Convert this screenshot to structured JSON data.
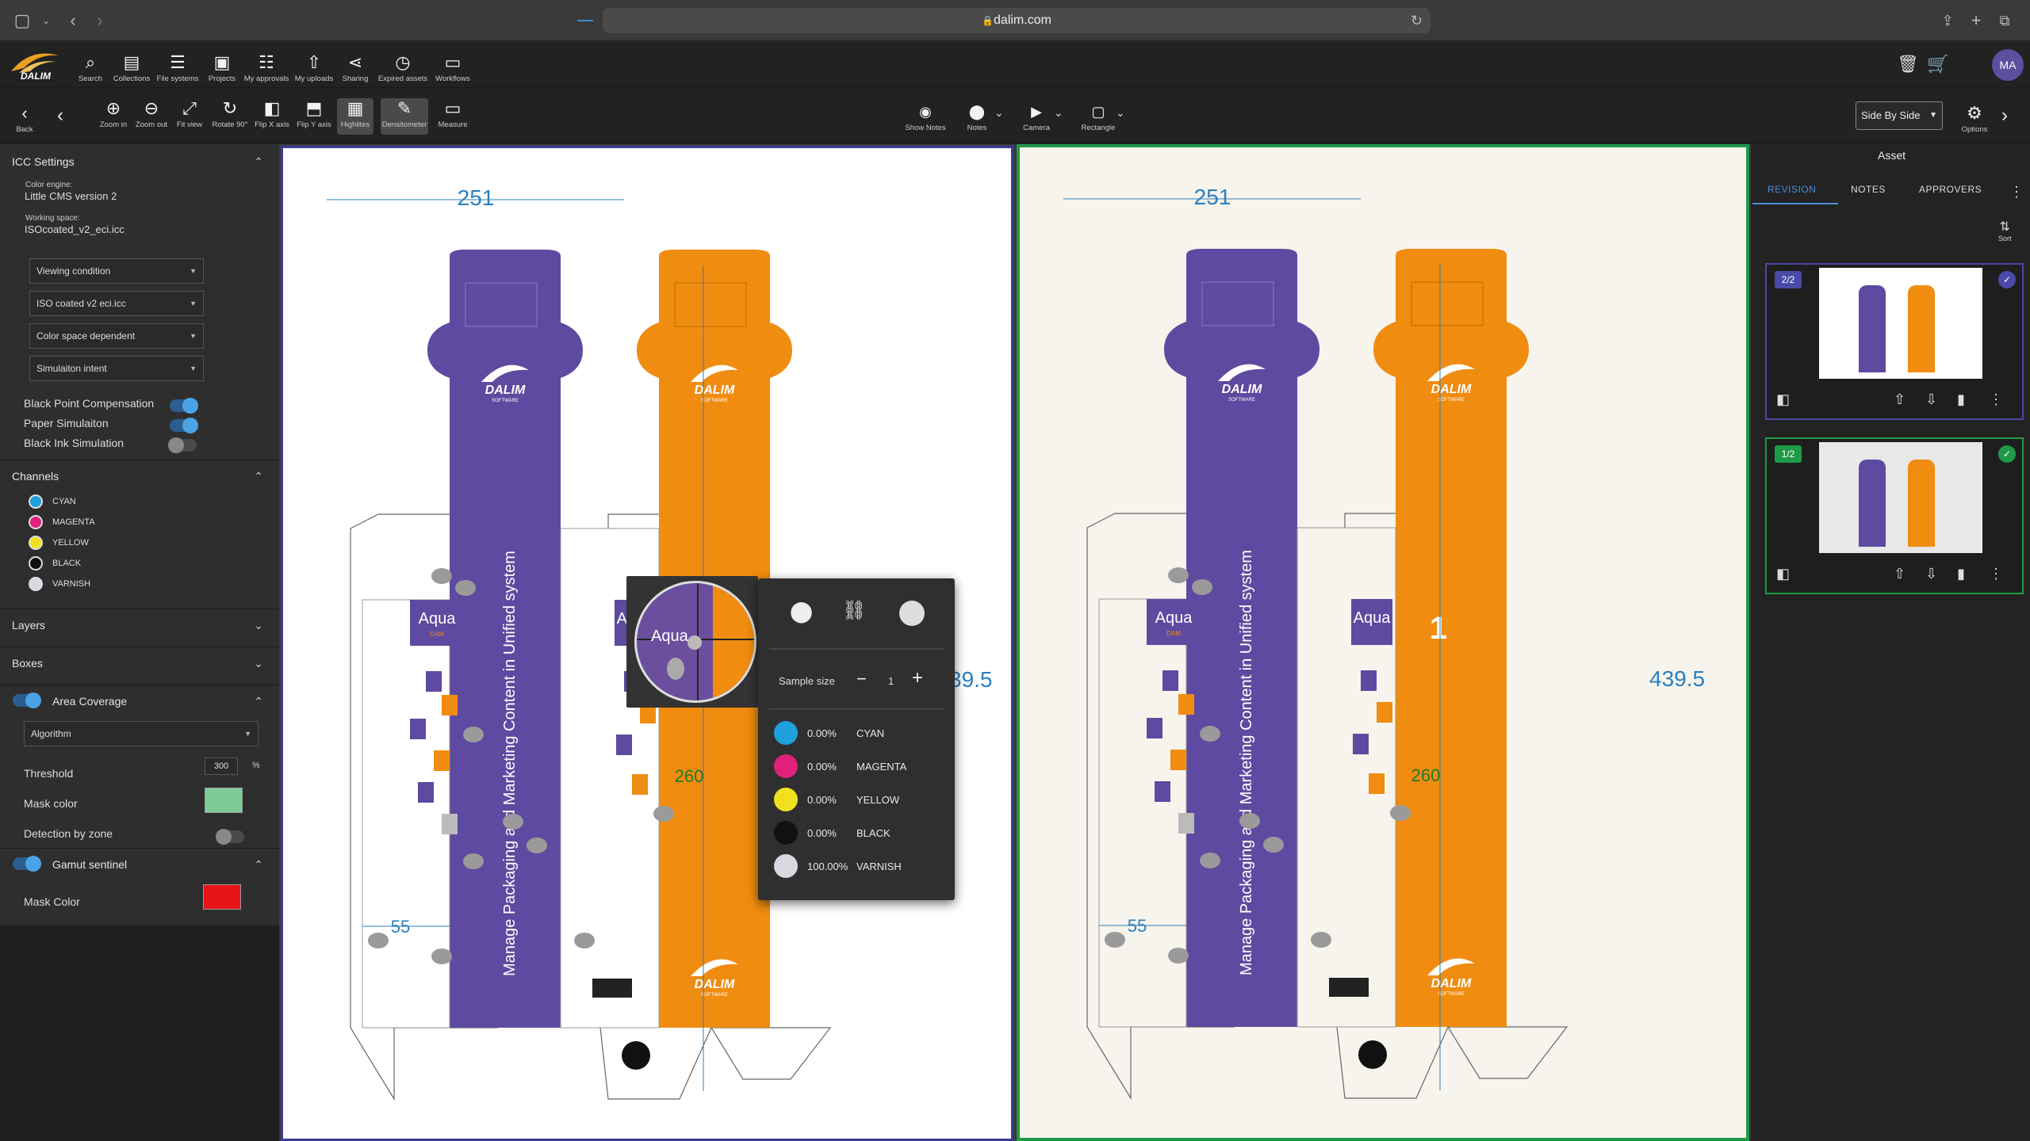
{
  "browser": {
    "url": "dalim.com"
  },
  "toolbar_main": {
    "items": [
      {
        "label": "Search",
        "icon": "search-icon"
      },
      {
        "label": "Collections",
        "icon": "collections-icon"
      },
      {
        "label": "File systems",
        "icon": "database-icon"
      },
      {
        "label": "Projects",
        "icon": "briefcase-icon"
      },
      {
        "label": "My approvals",
        "icon": "checklist-icon"
      },
      {
        "label": "My uploads",
        "icon": "upload-icon"
      },
      {
        "label": "Sharing",
        "icon": "share-icon"
      },
      {
        "label": "Expired assets",
        "icon": "clock-icon"
      },
      {
        "label": "Workflows",
        "icon": "monitor-icon"
      }
    ],
    "user_initials": "MA"
  },
  "toolbar_viewer": {
    "back_label": "Back",
    "tools": [
      {
        "label": "Zoom in",
        "icon": "zoom-in-icon"
      },
      {
        "label": "Zoom out",
        "icon": "zoom-out-icon"
      },
      {
        "label": "Fit view",
        "icon": "fit-view-icon"
      },
      {
        "label": "Rotate 90°",
        "icon": "rotate-icon"
      },
      {
        "label": "Flip X axis",
        "icon": "flip-x-icon"
      },
      {
        "label": "Flip Y axis",
        "icon": "flip-y-icon"
      },
      {
        "label": "Highlites",
        "icon": "highlight-icon"
      },
      {
        "label": "Densitometer",
        "icon": "pen-icon"
      },
      {
        "label": "Measure",
        "icon": "ruler-icon"
      }
    ],
    "center_tools": [
      {
        "label": "Show Notes",
        "icon": "eye-icon"
      },
      {
        "label": "Notes",
        "icon": "pin-icon"
      },
      {
        "label": "Camera",
        "icon": "camera-icon"
      },
      {
        "label": "Rectangle",
        "icon": "rectangle-icon"
      }
    ],
    "view_mode": "Side By Side",
    "options_label": "Options"
  },
  "icc": {
    "title": "ICC Settings",
    "color_engine_label": "Color engine:",
    "color_engine": "Little CMS version 2",
    "working_space_label": "Working space:",
    "working_space": "ISOcoated_v2_eci.icc",
    "dropdowns": [
      "Viewing condition",
      "ISO coated v2 eci.icc",
      "Color space dependent",
      "Simulaiton intent"
    ],
    "toggles": [
      {
        "label": "Black Point Compensation",
        "on": true
      },
      {
        "label": "Paper Simulaiton",
        "on": true
      },
      {
        "label": "Black Ink Simulation",
        "on": false
      }
    ]
  },
  "channels": {
    "title": "Channels",
    "items": [
      {
        "name": "CYAN",
        "color": "#1ea0dc"
      },
      {
        "name": "MAGENTA",
        "color": "#e0207a"
      },
      {
        "name": "YELLOW",
        "color": "#f0e020"
      },
      {
        "name": "BLACK",
        "color": "#111111"
      },
      {
        "name": "VARNISH",
        "color": "#d8d8e0"
      }
    ]
  },
  "layers": {
    "title": "Layers"
  },
  "boxes": {
    "title": "Boxes"
  },
  "area_coverage": {
    "title": "Area Coverage",
    "algorithm": "Algorithm",
    "threshold_label": "Threshold",
    "threshold_value": "300",
    "threshold_unit": "%",
    "mask_color_label": "Mask color",
    "mask_color": "#7ecb98",
    "detection_label": "Detection by zone"
  },
  "gamut": {
    "title": "Gamut sentinel",
    "mask_color_label": "Mask Color",
    "mask_color": "#e8141a"
  },
  "right_panel": {
    "title": "Asset",
    "tabs": [
      "REVISION",
      "NOTES",
      "APPROVERS"
    ],
    "sort_label": "Sort",
    "revisions": [
      {
        "badge": "2/2",
        "accent": "#4a4aa8"
      },
      {
        "badge": "1/2",
        "accent": "#1f9a48"
      }
    ]
  },
  "artwork": {
    "width_dim": "251",
    "height_dim_left": "39.5",
    "height_dim_right": "439.5",
    "inner_dim": "260",
    "side_dim": "55",
    "brand": "DALIM",
    "brand_sub": "SOFTWARE",
    "product": "Aqua",
    "product_sub": "DAM",
    "vertical_text": "Manage Packaging and Marketing Content in Unified system"
  },
  "densitometer": {
    "sample_size_label": "Sample size",
    "sample_size": "1",
    "readings": [
      {
        "name": "CYAN",
        "value": "0.00%",
        "color": "#1ea0dc"
      },
      {
        "name": "MAGENTA",
        "value": "0.00%",
        "color": "#e0207a"
      },
      {
        "name": "YELLOW",
        "value": "0.00%",
        "color": "#f0e020"
      },
      {
        "name": "BLACK",
        "value": "0.00%",
        "color": "#111111"
      },
      {
        "name": "VARNISH",
        "value": "100.00%",
        "color": "#d8d8e0"
      }
    ],
    "loupe_text": "Aqua"
  }
}
